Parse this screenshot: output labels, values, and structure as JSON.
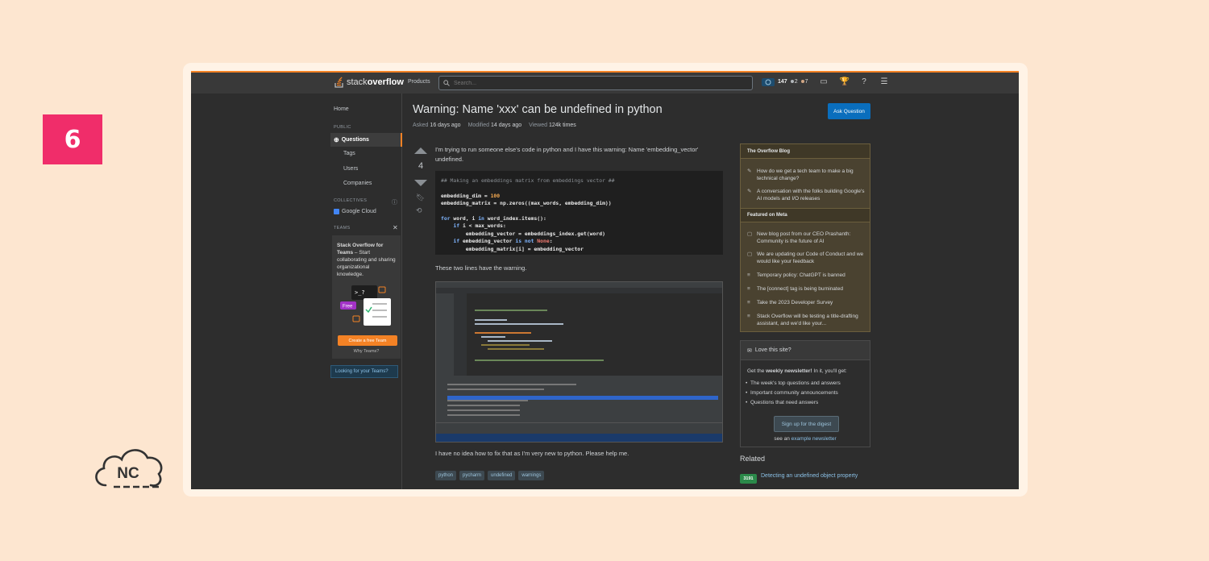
{
  "badge": {
    "number": "6"
  },
  "brand": {
    "logo_text": "NC"
  },
  "topbar": {
    "logo_light": "stack",
    "logo_bold": "overflow",
    "products": "Products",
    "search_placeholder": "Search...",
    "reputation": "147",
    "silver": "2",
    "bronze": "7"
  },
  "leftnav": {
    "home": "Home",
    "public": "PUBLIC",
    "questions": "Questions",
    "tags": "Tags",
    "users": "Users",
    "companies": "Companies",
    "collectives": "COLLECTIVES",
    "google_cloud": "Google Cloud",
    "teams": "TEAMS",
    "teams_title": "Stack Overflow for Teams",
    "teams_desc": " – Start collaborating and sharing organizational knowledge.",
    "free": "Free",
    "create_team": "Create a free Team",
    "why_teams": "Why Teams?",
    "looking": "Looking for your Teams?"
  },
  "question": {
    "title": "Warning: Name 'xxx' can be undefined in python",
    "asked_label": "Asked",
    "asked": "16 days ago",
    "modified_label": "Modified",
    "modified": "14 days ago",
    "viewed_label": "Viewed",
    "viewed": "124k times",
    "ask_button": "Ask Question",
    "votes": "4",
    "body_1": "I'm trying to run someone else's code in python and I have this warning: Name 'embedding_vector' undefined.",
    "code_comment": "## Making an embeddings matrix from embeddings vector ##",
    "code_l1a": "embedding_dim = ",
    "code_l1b": "100",
    "code_l2": "embedding_matrix = np.zeros((max_words, embedding_dim))",
    "code_l3a": "for",
    "code_l3b": " word, i ",
    "code_l3c": "in",
    "code_l3d": " word_index.items():",
    "code_l4a": "    if",
    "code_l4b": " i < max_words:",
    "code_l5": "        embedding_vector = embeddings_index.get(word)",
    "code_l6a": "    if",
    "code_l6b": " embedding_vector ",
    "code_l6c": "is not",
    "code_l6d": " None",
    "code_l6e": ":",
    "code_l7": "        embedding_matrix[i] = embedding_vector",
    "body_2": "These two lines have the warning.",
    "body_3": "I have no idea how to fix that as I'm very new to python. Please help me.",
    "tags": [
      "python",
      "pycharm",
      "undefined",
      "warnings"
    ]
  },
  "blog": {
    "header": "The Overflow Blog",
    "items": [
      "How do we get a tech team to make a big technical change?",
      "A conversation with the folks building Google's AI models and I/O releases"
    ],
    "meta_header": "Featured on Meta",
    "meta_items": [
      "New blog post from our CEO Prashanth: Community is the future of AI",
      "We are updating our Code of Conduct and we would like your feedback",
      "Temporary policy: ChatGPT is banned",
      "The [connect] tag is being burninated",
      "Take the 2023 Developer Survey",
      "Stack Overflow will be testing a title-drafting assistant, and we'd like your..."
    ]
  },
  "love": {
    "header": "Love this site?",
    "text_a": "Get the ",
    "text_b": "weekly newsletter!",
    "text_c": " In it, you'll get:",
    "items": [
      "The week's top questions and answers",
      "Important community announcements",
      "Questions that need answers"
    ],
    "signup": "Sign up for the digest",
    "example_a": "see an ",
    "example_b": "example newsletter"
  },
  "related": {
    "header": "Related",
    "score": "3191",
    "link": "Detecting an undefined object property"
  }
}
